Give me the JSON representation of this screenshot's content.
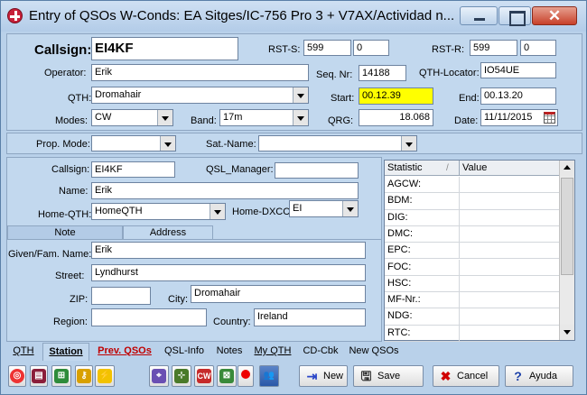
{
  "window": {
    "title": "Entry of QSOs   W-Conds: EA Sitges/IC-756 Pro 3 + V7AX/Actividad n..."
  },
  "qso": {
    "callsign_label": "Callsign:",
    "callsign_value": "EI4KF",
    "rst_s_label": "RST-S:",
    "rst_s_value": "599",
    "rst_s_extra": "0",
    "rst_r_label": "RST-R:",
    "rst_r_value": "599",
    "rst_r_extra": "0",
    "operator_label": "Operator:",
    "operator_value": "Erik",
    "seq_label": "Seq. Nr:",
    "seq_value": "14188",
    "locator_label": "QTH-Locator:",
    "locator_value": "IO54UE",
    "qth_label": "QTH:",
    "qth_value": "Dromahair",
    "start_label": "Start:",
    "start_value": "00.12.39",
    "end_label": "End:",
    "end_value": "00.13.20",
    "modes_label": "Modes:",
    "modes_value": "CW",
    "band_label": "Band:",
    "band_value": "17m",
    "qrg_label": "QRG:",
    "qrg_value": "18.068",
    "date_label": "Date:",
    "date_value": "11/11/2015"
  },
  "prop": {
    "prop_label": "Prop. Mode:",
    "prop_value": "",
    "sat_label": "Sat.-Name:",
    "sat_value": ""
  },
  "station": {
    "callsign_label": "Callsign:",
    "callsign_value": "EI4KF",
    "qsl_label": "QSL_Manager:",
    "qsl_value": "",
    "name_label": "Name:",
    "name_value": "Erik",
    "homeqth_label": "Home-QTH:",
    "homeqth_value": "HomeQTH",
    "homedxcc_label": "Home-DXCC",
    "homedxcc_value": "EI"
  },
  "subtabs": {
    "note": "Note",
    "address": "Address"
  },
  "address": {
    "given_label": "Given/Fam. Name:",
    "given_value": "Erik",
    "street_label": "Street:",
    "street_value": "Lyndhurst",
    "zip_label": "ZIP:",
    "zip_value": "",
    "city_label": "City:",
    "city_value": "Dromahair",
    "region_label": "Region:",
    "region_value": "",
    "country_label": "Country:",
    "country_value": "Ireland"
  },
  "stats": {
    "col_statistic": "Statistic",
    "col_value": "Value",
    "sort_indicator": "/",
    "rows": [
      "AGCW:",
      "BDM:",
      "DIG:",
      "DMC:",
      "EPC:",
      "FOC:",
      "HSC:",
      "MF-Nr.:",
      "NDG:",
      "RTC:"
    ]
  },
  "tabs": {
    "qth": "QTH",
    "station": "Station",
    "prev_qsos": "Prev. QSOs",
    "qsl_info": "QSL-Info",
    "notes": "Notes",
    "my_qth": "My QTH",
    "cd_cbk": "CD-Cbk",
    "new_qsos": "New QSOs"
  },
  "buttons": {
    "new": "New",
    "save": "Save",
    "cancel": "Cancel",
    "help": "Ayuda"
  },
  "colors": {
    "panel": "#c2d8ee",
    "start_highlight": "#ffff00",
    "prev_qsos_text": "#c00000"
  }
}
